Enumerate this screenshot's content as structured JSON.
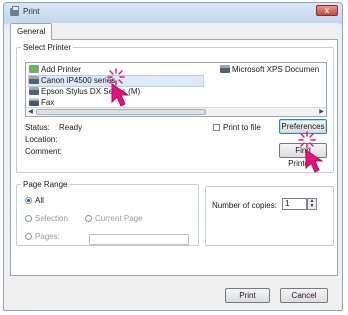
{
  "window": {
    "title": "Print",
    "close_glyph": "x"
  },
  "tabs": [
    {
      "label": "General"
    }
  ],
  "select_printer": {
    "legend": "Select Printer",
    "items": [
      {
        "label": "Add Printer",
        "icon": "add-printer-icon"
      },
      {
        "label": "Canon iP4500 series",
        "icon": "printer-icon",
        "selected": true
      },
      {
        "label": "Epson Stylus DX Series (M)",
        "icon": "printer-icon"
      },
      {
        "label": "Fax",
        "icon": "fax-icon"
      },
      {
        "label": "Microsoft XPS Documen",
        "icon": "printer-icon"
      }
    ]
  },
  "status": {
    "status_label": "Status:",
    "status_value": "Ready",
    "location_label": "Location:",
    "comment_label": "Comment:"
  },
  "print_to_file": {
    "label": "Print to file",
    "checked": false
  },
  "buttons": {
    "preferences": "Preferences",
    "find_printer": "Find Printer...",
    "print": "Print",
    "cancel": "Cancel"
  },
  "page_range": {
    "legend": "Page Range",
    "all": "All",
    "selection": "Selection",
    "current_page": "Current Page",
    "pages": "Pages:",
    "selected": "all"
  },
  "copies": {
    "label": "Number of copies:",
    "value": "1"
  },
  "accent": {
    "cursor": "#e0147a",
    "selection": "#dde9f6"
  }
}
